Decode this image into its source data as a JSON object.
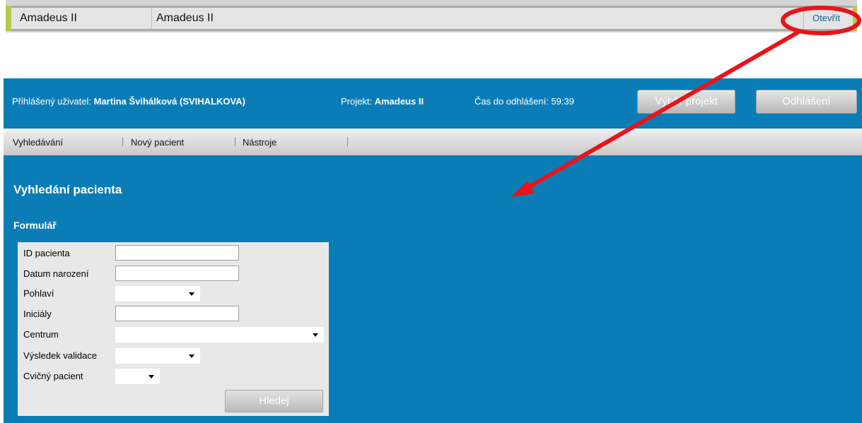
{
  "project_table": {
    "row": {
      "name": "Amadeus II",
      "title": "Amadeus II",
      "open_link": "Otevřít"
    }
  },
  "header": {
    "user_label": "Přihlášený uživatel:",
    "user_value": "Martina Švihálková (SVIHALKOVA)",
    "project_label": "Projekt:",
    "project_value": "Amadeus II",
    "timer_label": "Čas do odhlášení:",
    "timer_value": "59:39",
    "choose_project_button": "Výběr projekt",
    "logout_button": "Odhlášení"
  },
  "nav": {
    "items": [
      "Vyhledávání",
      "Nový pacient",
      "Nástroje"
    ]
  },
  "main": {
    "page_title": "Vyhledání pacienta",
    "form_title": "Formulář",
    "fields": {
      "patient_id": {
        "label": "ID pacienta",
        "value": ""
      },
      "birth_date": {
        "label": "Datum narození",
        "value": ""
      },
      "sex": {
        "label": "Pohlaví",
        "value": ""
      },
      "initials": {
        "label": "Iniciály",
        "value": ""
      },
      "center": {
        "label": "Centrum",
        "value": ""
      },
      "validation_result": {
        "label": "Výsledek validace",
        "value": ""
      },
      "practice_patient": {
        "label": "Cvičný pacient",
        "value": ""
      }
    },
    "search_button": "Hledej"
  },
  "colors": {
    "header_blue": "#0b7db6",
    "annotation_red": "#e8141a",
    "table_accent": "#b5c94b"
  }
}
